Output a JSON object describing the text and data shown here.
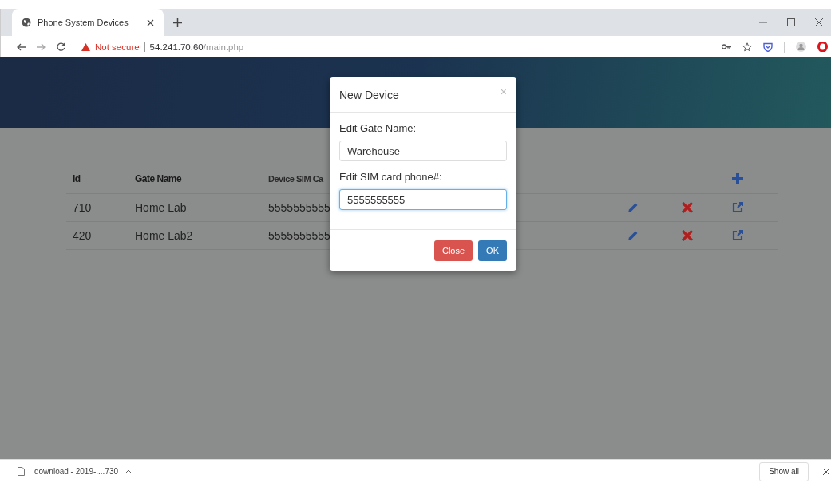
{
  "browser": {
    "tab_title": "Phone System Devices",
    "security_label": "Not secure",
    "url_host": "54.241.70.60",
    "url_path": "/main.php"
  },
  "table": {
    "columns": [
      "Id",
      "Gate Name",
      "Device SIM Ca"
    ],
    "rows": [
      {
        "cells": [
          "710",
          "Home Lab",
          "5555555555"
        ]
      },
      {
        "cells": [
          "420",
          "Home Lab2",
          "5555555555"
        ]
      }
    ]
  },
  "dialog": {
    "title": "New Device",
    "close_glyph": "×",
    "fields": [
      {
        "label": "Edit Gate Name:",
        "value": "Warehouse",
        "focused": false
      },
      {
        "label": "Edit SIM card phone#:",
        "value": "5555555555",
        "focused": true
      }
    ],
    "buttons": [
      {
        "label": "Close",
        "kind": "danger"
      },
      {
        "label": "OK",
        "kind": "primary"
      }
    ]
  },
  "downloads": {
    "file": "download - 2019-....730",
    "show_all": "Show all"
  }
}
